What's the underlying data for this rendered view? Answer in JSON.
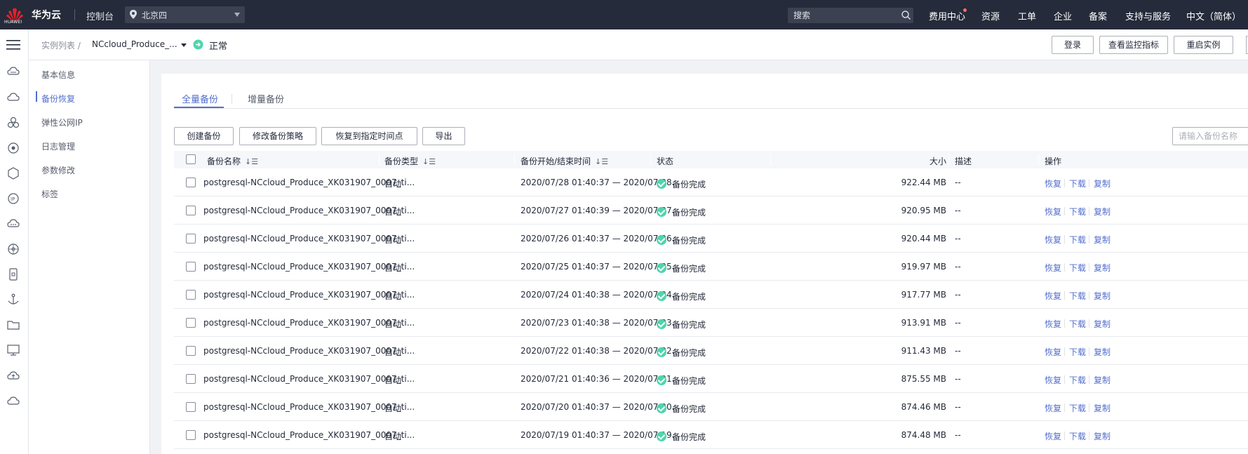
{
  "topbar": {
    "logo_text": "HUAWEI",
    "brand": "华为云",
    "console": "控制台",
    "region": "北京四",
    "search_placeholder": "搜索",
    "nav": [
      "费用中心",
      "资源",
      "工单",
      "企业",
      "备案",
      "支持与服务",
      "中文（简体）"
    ]
  },
  "header": {
    "breadcrumb": "实例列表 /",
    "instance_name": "NCcloud_Produce_...",
    "status": "正常",
    "buttons": [
      "登录",
      "查看监控指标",
      "重启实例"
    ]
  },
  "sidebar": {
    "items": [
      "基本信息",
      "备份恢复",
      "弹性公网IP",
      "日志管理",
      "参数修改",
      "标签"
    ],
    "active_index": 1
  },
  "tabs": [
    "全量备份",
    "增量备份"
  ],
  "toolbar": {
    "buttons": [
      "创建备份",
      "修改备份策略",
      "恢复到指定时间点",
      "导出"
    ],
    "filter_placeholder": "请输入备份名称"
  },
  "table": {
    "columns": [
      "备份名称",
      "备份类型",
      "备份开始/结束时间",
      "状态",
      "大小",
      "描述",
      "操作"
    ],
    "sort_glyph": "↓☰",
    "rows": [
      {
        "name": "postgresql-NCcloud_Produce_XK031907_0007_ti...",
        "type": "自动",
        "time": "2020/07/28 01:40:37 — 2020/07/28...",
        "status": "备份完成",
        "size": "922.44 MB",
        "desc": "--"
      },
      {
        "name": "postgresql-NCcloud_Produce_XK031907_0007_ti...",
        "type": "自动",
        "time": "2020/07/27 01:40:39 — 2020/07/27...",
        "status": "备份完成",
        "size": "920.95 MB",
        "desc": "--"
      },
      {
        "name": "postgresql-NCcloud_Produce_XK031907_0007_ti...",
        "type": "自动",
        "time": "2020/07/26 01:40:37 — 2020/07/26...",
        "status": "备份完成",
        "size": "920.44 MB",
        "desc": "--"
      },
      {
        "name": "postgresql-NCcloud_Produce_XK031907_0007_ti...",
        "type": "自动",
        "time": "2020/07/25 01:40:37 — 2020/07/25...",
        "status": "备份完成",
        "size": "919.97 MB",
        "desc": "--"
      },
      {
        "name": "postgresql-NCcloud_Produce_XK031907_0007_ti...",
        "type": "自动",
        "time": "2020/07/24 01:40:38 — 2020/07/24...",
        "status": "备份完成",
        "size": "917.77 MB",
        "desc": "--"
      },
      {
        "name": "postgresql-NCcloud_Produce_XK031907_0007_ti...",
        "type": "自动",
        "time": "2020/07/23 01:40:38 — 2020/07/23...",
        "status": "备份完成",
        "size": "913.91 MB",
        "desc": "--"
      },
      {
        "name": "postgresql-NCcloud_Produce_XK031907_0007_ti...",
        "type": "自动",
        "time": "2020/07/22 01:40:38 — 2020/07/22...",
        "status": "备份完成",
        "size": "911.43 MB",
        "desc": "--"
      },
      {
        "name": "postgresql-NCcloud_Produce_XK031907_0007_ti...",
        "type": "自动",
        "time": "2020/07/21 01:40:36 — 2020/07/21...",
        "status": "备份完成",
        "size": "875.55 MB",
        "desc": "--"
      },
      {
        "name": "postgresql-NCcloud_Produce_XK031907_0007_ti...",
        "type": "自动",
        "time": "2020/07/20 01:40:37 — 2020/07/20...",
        "status": "备份完成",
        "size": "874.46 MB",
        "desc": "--"
      },
      {
        "name": "postgresql-NCcloud_Produce_XK031907_0007_ti...",
        "type": "自动",
        "time": "2020/07/19 01:40:37 — 2020/07/19...",
        "status": "备份完成",
        "size": "874.48 MB",
        "desc": "--"
      }
    ],
    "actions": [
      "恢复",
      "下载",
      "复制"
    ]
  },
  "rail_icons": [
    "cloud-server-icon",
    "cloud-icon",
    "cluster-icon",
    "eye-icon",
    "cube-icon",
    "ip-icon",
    "cloud-dots-icon",
    "network-icon",
    "mobile-icon",
    "anchor-icon",
    "folder-icon",
    "monitor-icon",
    "cloud-upload-icon",
    "cloud-outline-icon"
  ],
  "colors": {
    "accent": "#526ecc",
    "topbar": "#252b3a",
    "success": "#50d4ab"
  }
}
